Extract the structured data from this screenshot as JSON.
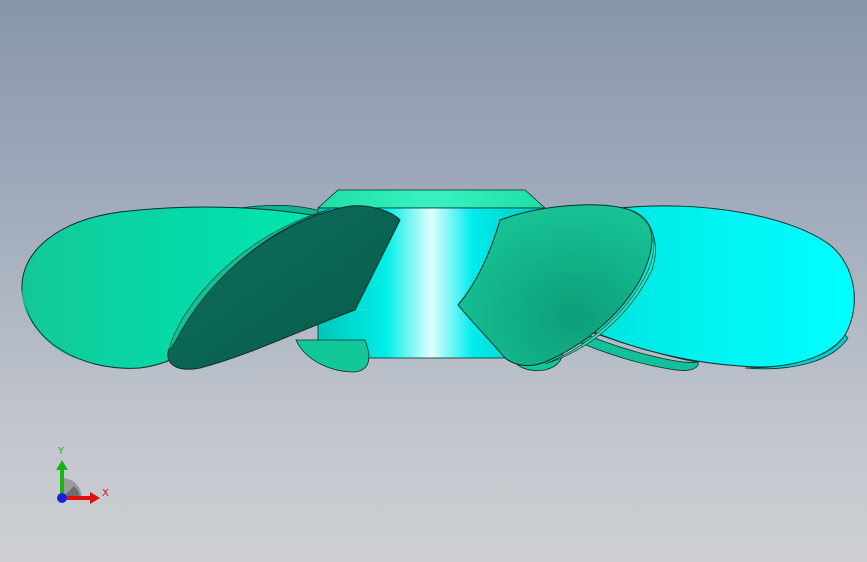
{
  "viewport": {
    "background_top": "#8795ab",
    "background_bottom": "#cdcfd3"
  },
  "model": {
    "description_icon": "propeller-model",
    "colors": {
      "blade_light": "#05d3a0",
      "blade_cyan": "#00f5f5",
      "blade_dark": "#0a6e58",
      "hub_highlight": "#d8ffff",
      "edge": "#0b2f28"
    }
  },
  "triad": {
    "x_label": "X",
    "y_label": "Y",
    "x_color": "#e01010",
    "y_color": "#18b418",
    "z_color": "#1a22d8"
  }
}
